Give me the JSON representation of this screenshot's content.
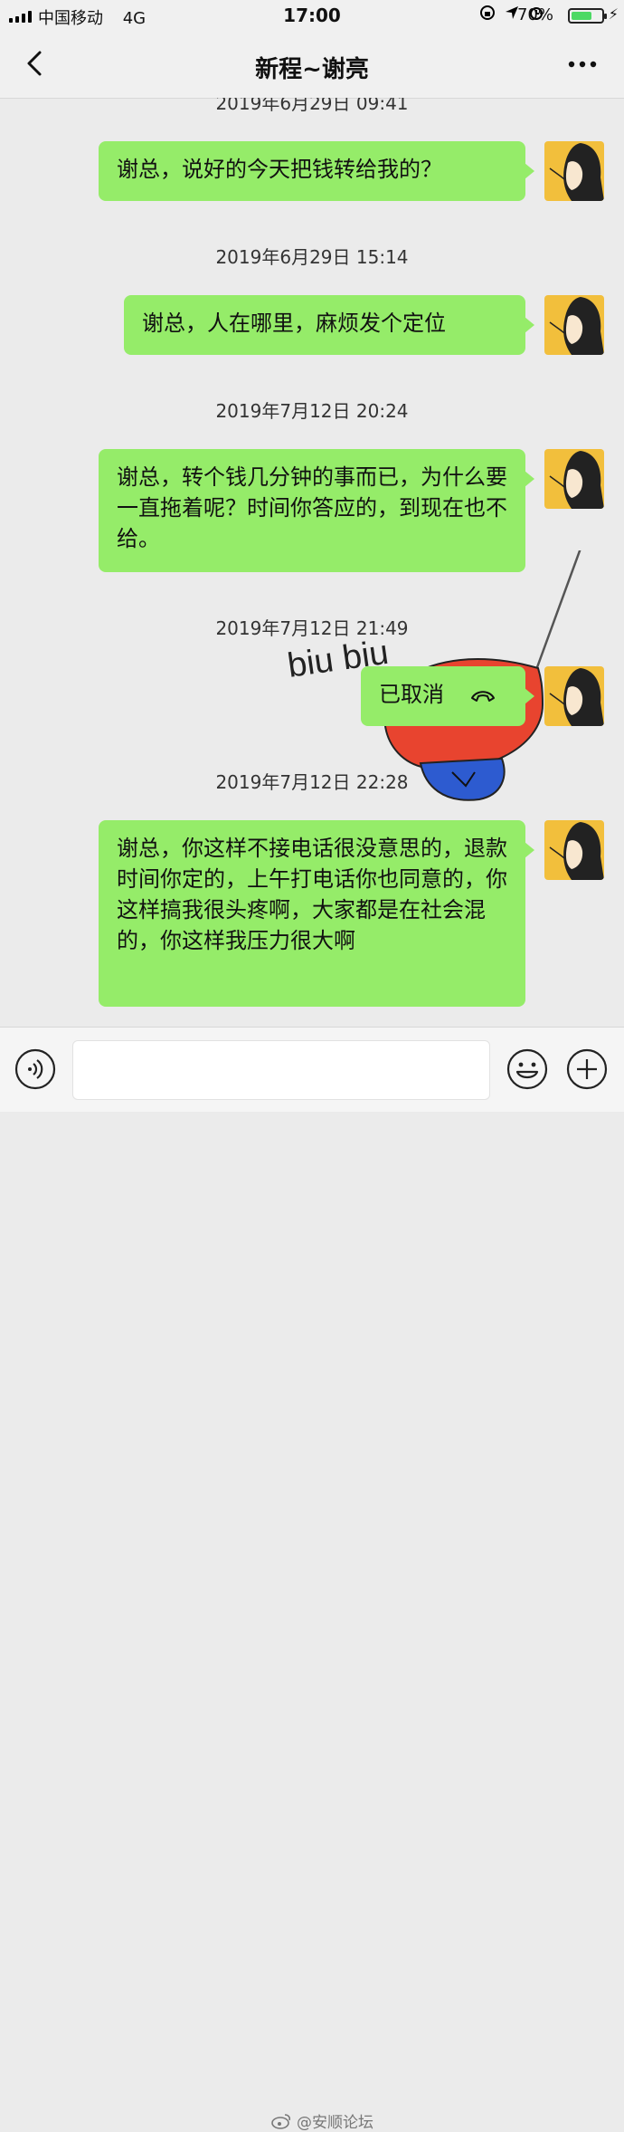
{
  "status_bar": {
    "carrier": "中国移动",
    "network": "4G",
    "time": "17:00",
    "battery_percent_label": "70%",
    "battery_level": 0.7
  },
  "header": {
    "title": "新程~谢亮"
  },
  "messages": [
    {
      "timestamp": "2019年6月29日 09:41"
    },
    {
      "text": "谢总，说好的今天把钱转给我的？"
    },
    {
      "timestamp": "2019年6月29日 15:14"
    },
    {
      "text": "谢总，人在哪里，麻烦发个定位"
    },
    {
      "timestamp": "2019年7月12日 20:24"
    },
    {
      "text": "谢总，转个钱几分钟的事而已，为什么要一直拖着呢？时间你答应的，到现在也不给。"
    },
    {
      "timestamp": "2019年7月12日 21:49"
    },
    {
      "text": "已取消"
    },
    {
      "timestamp": "2019年7月12日 22:28"
    },
    {
      "text": "谢总，你这样不接电话很没意思的，退款时间你定的，上午打电话你也同意的，你这样搞我很头疼啊，大家都是在社会混的，你这样我压力很大啊"
    }
  ],
  "sticker": {
    "text": "biu biu"
  },
  "watermark": {
    "text": "@安顺论坛"
  },
  "colors": {
    "bubble": "#95ec69",
    "background": "#ebebeb",
    "avatar": "#f2bf3c"
  },
  "icons": [
    "back-chevron-icon",
    "more-dots-icon",
    "voice-icon",
    "emoji-icon",
    "plus-icon",
    "call-cancel-icon"
  ]
}
